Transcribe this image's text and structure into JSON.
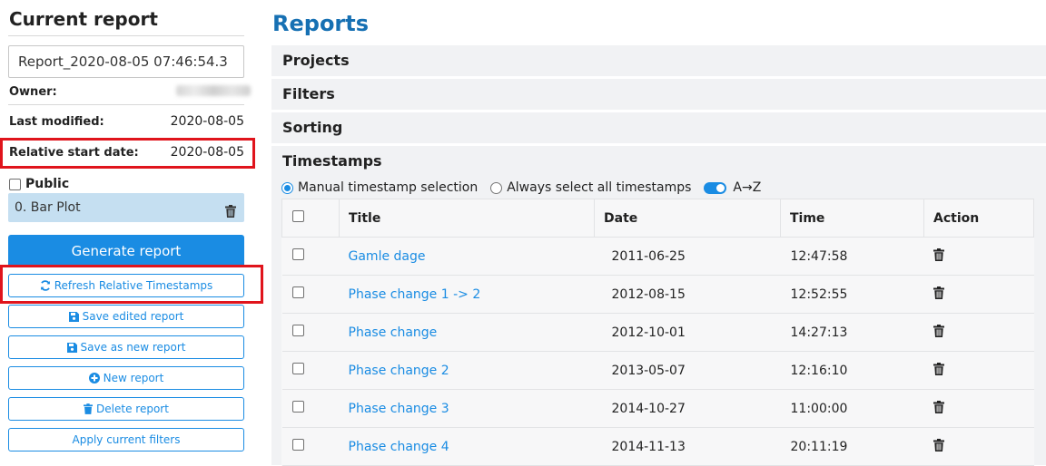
{
  "current_report": {
    "title": "Current report",
    "name_value": "Report_2020-08-05 07:46:54.3",
    "owner_label": "Owner:",
    "last_modified_label": "Last modified:",
    "last_modified_value": "2020-08-05",
    "relative_start_label": "Relative start date:",
    "relative_start_value": "2020-08-05",
    "public_label": "Public",
    "plot_item": "0. Bar Plot",
    "buttons": {
      "generate": "Generate report",
      "refresh": "Refresh Relative Timestamps",
      "save_edited": "Save edited report",
      "save_new": "Save as new report",
      "new": "New report",
      "delete": "Delete report",
      "apply_filters": "Apply current filters"
    }
  },
  "reports": {
    "title": "Reports",
    "sections": [
      "Projects",
      "Filters",
      "Sorting"
    ],
    "timestamps": {
      "title": "Timestamps",
      "radio_manual": "Manual timestamp selection",
      "radio_always": "Always select all timestamps",
      "sort_label": "A→Z",
      "columns": [
        "Title",
        "Date",
        "Time",
        "Action"
      ],
      "rows": [
        {
          "title": "Gamle dage",
          "date": "2011-06-25",
          "time": "12:47:58"
        },
        {
          "title": "Phase change 1 -> 2",
          "date": "2012-08-15",
          "time": "12:52:55"
        },
        {
          "title": "Phase change",
          "date": "2012-10-01",
          "time": "14:27:13"
        },
        {
          "title": "Phase change 2",
          "date": "2013-05-07",
          "time": "12:16:10"
        },
        {
          "title": "Phase change 3",
          "date": "2014-10-27",
          "time": "11:00:00"
        },
        {
          "title": "Phase change 4",
          "date": "2014-11-13",
          "time": "20:11:19"
        }
      ]
    }
  },
  "colors": {
    "accent": "#1a8ce3",
    "heading_blue": "#1670b3",
    "highlight_red": "#e0141c",
    "plot_item_bg": "#c5dff1"
  }
}
